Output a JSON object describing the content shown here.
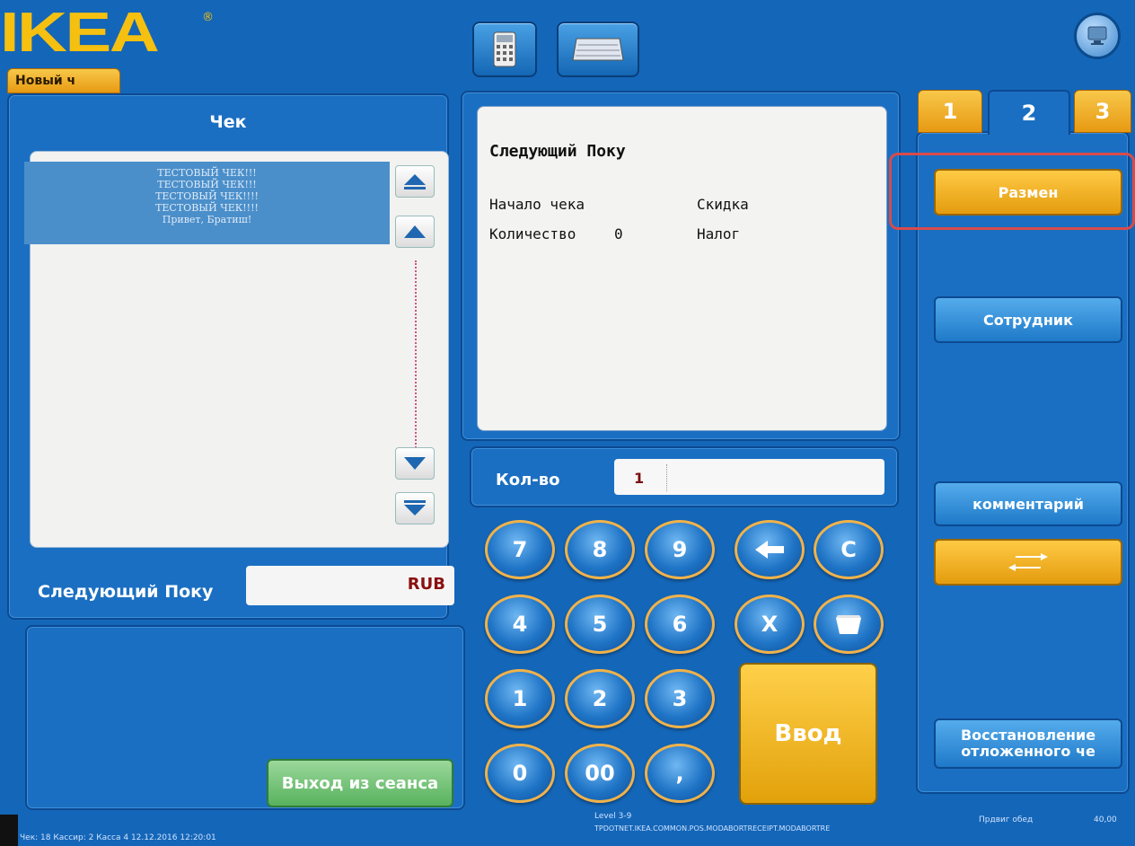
{
  "app": {
    "logo": "IKEA",
    "logo_mark": "®"
  },
  "header": {
    "tab_label": "Новый ч"
  },
  "receipt": {
    "title": "Чек",
    "lines": [
      "ТЕСТОВЫЙ ЧЕК!!!",
      "ТЕСТОВЫЙ ЧЕК!!!",
      "ТЕСТОВЫЙ ЧЕК!!!!",
      "ТЕСТОВЫЙ ЧЕК!!!!",
      "Привет, Братиш!"
    ],
    "next_buyer_label": "Следующий Поку",
    "currency": "RUB"
  },
  "info": {
    "header": "Следующий Поку",
    "receipt_start_label": "Начало чека",
    "discount_label": "Скидка",
    "quantity_label": "Количество",
    "quantity_value": "0",
    "tax_label": "Налог"
  },
  "qty": {
    "label": "Кол-во",
    "value": "1"
  },
  "keypad": {
    "keys": [
      "7",
      "8",
      "9",
      "4",
      "5",
      "6",
      "1",
      "2",
      "3",
      "0",
      "00",
      ","
    ],
    "clear": "C",
    "multiply": "X",
    "enter": "Ввод"
  },
  "right": {
    "tabs": [
      "1",
      "2",
      "3"
    ],
    "change_button": "Размен",
    "employee_button": "Сотрудник",
    "comment_button": "комментарий",
    "restore_button_line1": "Восстановление",
    "restore_button_line2": "отложенного че"
  },
  "bottom": {
    "logout_button": "Выход из сеанса"
  },
  "footer": {
    "left_text": "Чек: 18     Кассир: 2     Касса 4     12.12.2016     12:20:01",
    "level": "Level 3-9",
    "route": "TPDOTNET.IKEA.COMMON.POS.MODABORTRECEIPT.MODABORTRE",
    "lunch": "Прдвиг обед",
    "amount": "40,00"
  },
  "colors": {
    "brand_yellow": "#f5c010",
    "background_blue": "#1466b8",
    "highlight_red": "#d84b4b"
  }
}
